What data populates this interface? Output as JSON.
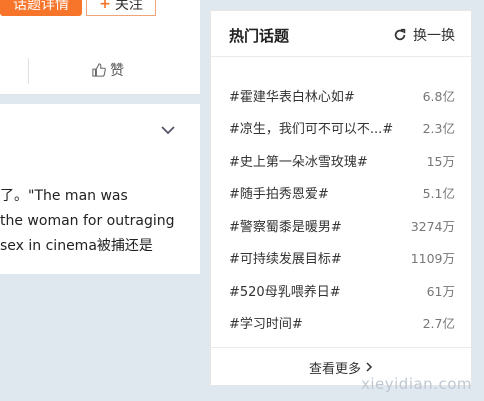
{
  "left": {
    "topic_detail_label": "话题详情",
    "follow_label": "关注",
    "follow_plus": "+",
    "like_label": "赞"
  },
  "post": {
    "lines": [
      "了。\"The man was",
      "the woman for outraging",
      "sex in cinema被捕还是"
    ]
  },
  "hot": {
    "title": "热门话题",
    "refresh_label": "换一换",
    "topics": [
      {
        "name": "#霍建华表白林心如#",
        "count": "6.8亿"
      },
      {
        "name": "#凉生，我们可不可以不...#",
        "count": "2.3亿"
      },
      {
        "name": "#史上第一朵冰雪玫瑰#",
        "count": "15万"
      },
      {
        "name": "#随手拍秀恩爱#",
        "count": "5.1亿"
      },
      {
        "name": "#警察蜀黍是暖男#",
        "count": "3274万"
      },
      {
        "name": "#可持续发展目标#",
        "count": "1109万"
      },
      {
        "name": "#520母乳喂养日#",
        "count": "61万"
      },
      {
        "name": "#学习时间#",
        "count": "2.7亿"
      }
    ],
    "more_label": "查看更多"
  },
  "watermark": "xieyidian.com",
  "colors": {
    "accent": "#f7752a",
    "bg": "#dfe8ef"
  }
}
